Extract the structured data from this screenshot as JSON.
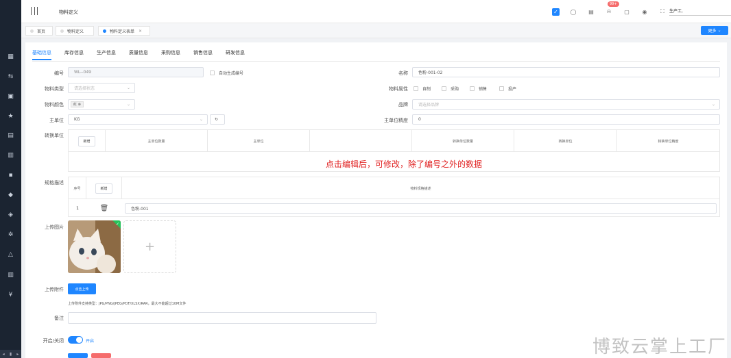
{
  "topbar": {
    "page_title": "物料定义",
    "badge": "99+",
    "user": "生产工,"
  },
  "tabs": [
    {
      "label": "首页"
    },
    {
      "label": "物料定义"
    },
    {
      "label": "物料定义表单",
      "close": "×"
    }
  ],
  "more_button": "更多",
  "subtabs": [
    "基础信息",
    "库存信息",
    "生产信息",
    "质量信息",
    "采购信息",
    "销售信息",
    "研发信息"
  ],
  "form": {
    "code_label": "编号",
    "code_value": "WL--049",
    "auto_code_label": "自动生成编号",
    "name_label": "名称",
    "name_value": "色粉-001-02",
    "type_label": "物料类型",
    "type_placeholder": "请选择状态",
    "attr_label": "物料属性",
    "attrs": [
      "自制",
      "采购",
      "销售",
      "投产"
    ],
    "color_label": "物料颜色",
    "color_tag": "红",
    "brand_label": "品牌",
    "brand_placeholder": "请选择品牌",
    "unit_label": "主单位",
    "unit_value": "KG",
    "precision_label": "主单位精度",
    "precision_value": "0",
    "convert_label": "转换单位",
    "convert_headers": [
      "新增",
      "主单位数量",
      "主单位",
      "",
      "转换单位数量",
      "转换单位",
      "转换单位精度"
    ],
    "note": "点击编辑后，可修改，除了编号之外的数据",
    "spec_label": "规格描述",
    "spec_headers": {
      "index": "序号",
      "add": "新增",
      "desc": "物料规格描述"
    },
    "spec_rows": [
      {
        "index": "1",
        "desc": "色粉-001"
      }
    ],
    "image_label": "上传图片",
    "attach_label": "上传附件",
    "upload_button": "点击上传",
    "attach_hint": "上传附件支持类型：JPG/PNG/JPEG/PDF/XLSX/RAR，最大不能超过10M文件",
    "remark_label": "备注",
    "switch_label": "开启/关闭",
    "switch_state": "开启"
  },
  "watermark": "博致云掌上工厂"
}
